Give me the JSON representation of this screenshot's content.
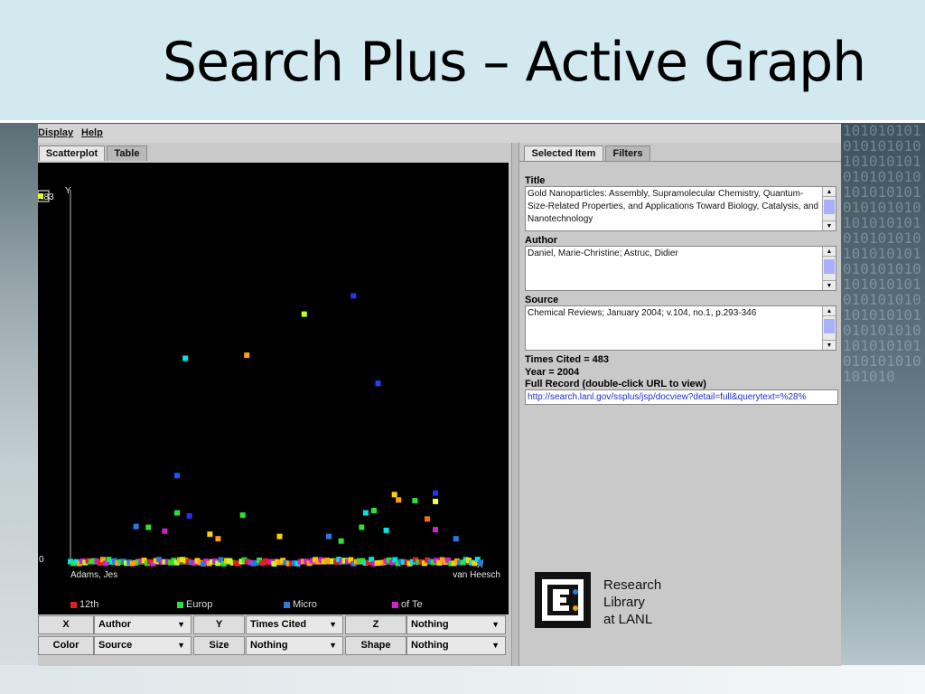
{
  "slide": {
    "title": "Search Plus – Active Graph",
    "binary_pattern": "101010101010101010101010101010101010101010101010101010101010101010101010101010101010101010101010101010101010101010101010101010101010101010101010101010"
  },
  "menu": [
    "Display",
    "Help"
  ],
  "left_tabs": [
    {
      "label": "Scatterplot",
      "active": true
    },
    {
      "label": "Table",
      "active": false
    }
  ],
  "chart_data": {
    "type": "scatter",
    "ylabel": "Y",
    "xlabel": "X",
    "ylim": [
      0,
      483
    ],
    "y_tick_labels": [
      "483",
      "0"
    ],
    "x_tick_labels": [
      "Adams, Jes",
      "van Heesch"
    ],
    "highlighted_point": {
      "x_rank": 0.18,
      "y": 483,
      "color": "#e6ff3a"
    },
    "series_colors": {
      "12th": "#e02020",
      "Europ": "#30e030",
      "Micro": "#2a7ae0",
      "of Te": "#d020d0"
    },
    "points": [
      {
        "x": 0.28,
        "y": 270,
        "color": "#00e5e5"
      },
      {
        "x": 0.43,
        "y": 274,
        "color": "#ff9f1a"
      },
      {
        "x": 0.57,
        "y": 328,
        "color": "#b8ff30"
      },
      {
        "x": 0.69,
        "y": 352,
        "color": "#2233ff"
      },
      {
        "x": 0.75,
        "y": 237,
        "color": "#2244ff"
      },
      {
        "x": 0.26,
        "y": 116,
        "color": "#2255ff"
      },
      {
        "x": 0.26,
        "y": 67,
        "color": "#30e030"
      },
      {
        "x": 0.29,
        "y": 63,
        "color": "#2233ff"
      },
      {
        "x": 0.16,
        "y": 49,
        "color": "#2a7ae0"
      },
      {
        "x": 0.19,
        "y": 48,
        "color": "#30e030"
      },
      {
        "x": 0.23,
        "y": 43,
        "color": "#d020d0"
      },
      {
        "x": 0.34,
        "y": 39,
        "color": "#ffd000"
      },
      {
        "x": 0.36,
        "y": 33,
        "color": "#ff9f1a"
      },
      {
        "x": 0.42,
        "y": 64,
        "color": "#30e030"
      },
      {
        "x": 0.51,
        "y": 36,
        "color": "#ffd000"
      },
      {
        "x": 0.72,
        "y": 67,
        "color": "#00e5e5"
      },
      {
        "x": 0.74,
        "y": 70,
        "color": "#30e030"
      },
      {
        "x": 0.71,
        "y": 48,
        "color": "#30e030"
      },
      {
        "x": 0.77,
        "y": 44,
        "color": "#00e5e5"
      },
      {
        "x": 0.79,
        "y": 91,
        "color": "#ffd000"
      },
      {
        "x": 0.8,
        "y": 84,
        "color": "#ff9f1a"
      },
      {
        "x": 0.84,
        "y": 83,
        "color": "#30e030"
      },
      {
        "x": 0.87,
        "y": 59,
        "color": "#ff6a00"
      },
      {
        "x": 0.89,
        "y": 82,
        "color": "#ffff40"
      },
      {
        "x": 0.89,
        "y": 93,
        "color": "#2233ff"
      },
      {
        "x": 0.89,
        "y": 45,
        "color": "#d020d0"
      },
      {
        "x": 0.94,
        "y": 33,
        "color": "#2a7ae0"
      },
      {
        "x": 0.63,
        "y": 36,
        "color": "#2a7ae0"
      },
      {
        "x": 0.66,
        "y": 30,
        "color": "#30e030"
      }
    ]
  },
  "legend": [
    {
      "label": "12th",
      "color": "#e02020"
    },
    {
      "label": "Europ",
      "color": "#30e030"
    },
    {
      "label": "Micro",
      "color": "#2a7ae0"
    },
    {
      "label": "of Te",
      "color": "#d020d0"
    }
  ],
  "controls": {
    "row1": [
      {
        "label": "X",
        "value": "Author"
      },
      {
        "label": "Y",
        "value": "Times Cited"
      },
      {
        "label": "Z",
        "value": "Nothing"
      }
    ],
    "row2": [
      {
        "label": "Color",
        "value": "Source"
      },
      {
        "label": "Size",
        "value": "Nothing"
      },
      {
        "label": "Shape",
        "value": "Nothing"
      }
    ]
  },
  "right_tabs": [
    {
      "label": "Selected Item",
      "active": true
    },
    {
      "label": "Filters",
      "active": false
    }
  ],
  "selected": {
    "title_label": "Title",
    "title_value": "Gold Nanoparticles: Assembly, Supramolecular Chemistry, Quantum-Size-Related Properties, and Applications Toward Biology, Catalysis, and Nanotechnology",
    "author_label": "Author",
    "author_value": "Daniel, Marie-Christine; Astruc, Didier",
    "source_label": "Source",
    "source_value": "Chemical Reviews; January 2004; v.104, no.1, p.293-346",
    "times_cited": "Times Cited = 483",
    "year": "Year = 2004",
    "full_record_label": "Full Record (double-click URL to view)",
    "url": "http://search.lanl.gov/ssplus/jsp/docview?detail=full&querytext=%28%"
  },
  "logo": {
    "lines": [
      "Research",
      "Library",
      "at LANL"
    ]
  }
}
